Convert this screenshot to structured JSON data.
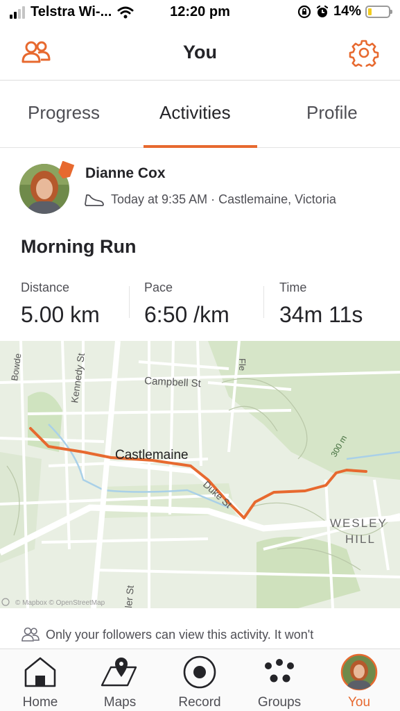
{
  "status_bar": {
    "carrier": "Telstra Wi-...",
    "time": "12:20 pm",
    "battery": "14%"
  },
  "header": {
    "title": "You",
    "left_icon": "people-icon",
    "right_icon": "gear-icon",
    "accent_color": "#e7692f"
  },
  "tabs": [
    {
      "label": "Progress"
    },
    {
      "label": "Activities",
      "selected": true
    },
    {
      "label": "Profile"
    }
  ],
  "activity": {
    "athlete": "Dianne Cox",
    "sport_icon": "shoe-icon",
    "time_location": "Today at 9:35 AM · Castlemaine, Victoria",
    "title": "Morning Run",
    "stats": [
      {
        "label": "Distance",
        "value": "5.00 km"
      },
      {
        "label": "Pace",
        "value": "6:50 /km"
      },
      {
        "label": "Time",
        "value": "34m 11s"
      }
    ]
  },
  "map": {
    "labels": {
      "town": "Castlemaine",
      "campbell": "Campbell St",
      "kennedy": "Kennedy St",
      "bowden": "Bowde",
      "fle": "Fle",
      "duke": "Duke St",
      "elevation": "300 m",
      "wesley": "WESLEY",
      "hill": "HILL",
      "ler": "ler St",
      "attribution": "© Mapbox © OpenStreetMap"
    },
    "route_color": "#e7692f"
  },
  "privacy_note": "Only your followers can view this activity. It won't",
  "bottom_nav": [
    {
      "label": "Home",
      "icon": "home-icon"
    },
    {
      "label": "Maps",
      "icon": "map-icon"
    },
    {
      "label": "Record",
      "icon": "record-icon"
    },
    {
      "label": "Groups",
      "icon": "groups-icon"
    },
    {
      "label": "You",
      "icon": "avatar-icon",
      "active": true
    }
  ]
}
